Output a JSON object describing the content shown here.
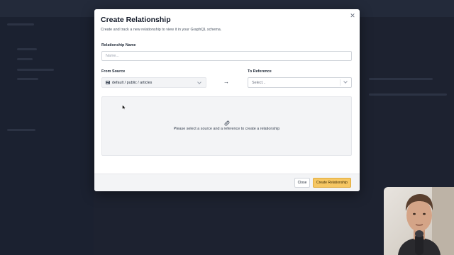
{
  "modal": {
    "title": "Create Relationship",
    "subtitle": "Create and track a new relationship to view it in your GraphQL schema.",
    "close_icon": "close-icon"
  },
  "relationship_name": {
    "label": "Relationship Name",
    "placeholder": "Name...",
    "value": ""
  },
  "from_source": {
    "label": "From Source",
    "value": "default / public / articles",
    "icon": "table-icon"
  },
  "to_reference": {
    "label": "To Reference",
    "placeholder": "Select..."
  },
  "preview": {
    "icon": "link-icon",
    "message": "Please select a source and a reference to create a relationship"
  },
  "footer": {
    "close_label": "Close",
    "create_label": "Create Relationship"
  },
  "colors": {
    "primary_button": "#f6c763",
    "overlay": "#1f2430"
  }
}
